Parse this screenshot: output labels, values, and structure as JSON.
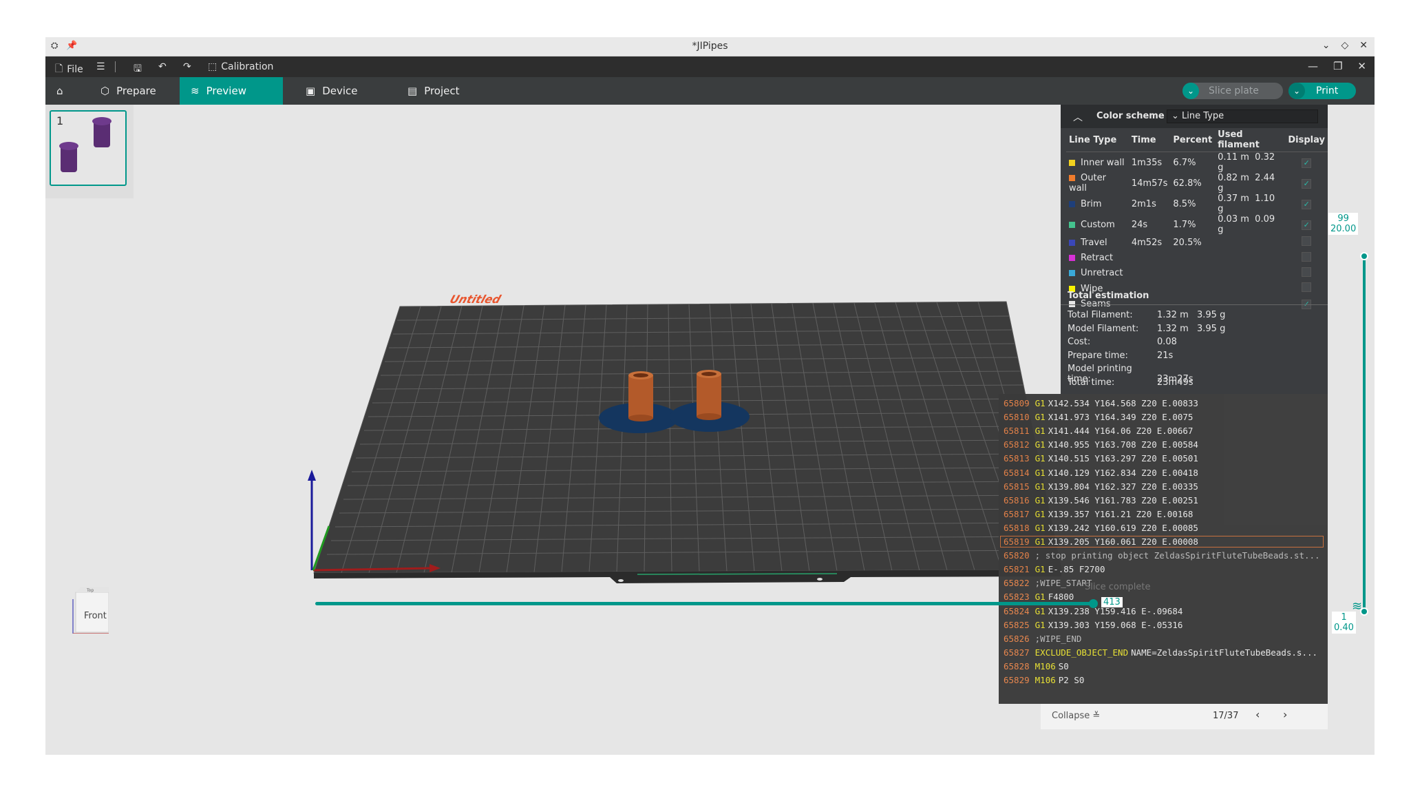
{
  "window": {
    "title": "*JIPipes"
  },
  "menubar": {
    "file_label": "File",
    "calibration_label": "Calibration"
  },
  "tabs": {
    "prepare": "Prepare",
    "preview": "Preview",
    "device": "Device",
    "project": "Project",
    "slice_plate": "Slice plate",
    "print": "Print"
  },
  "plate": {
    "thumb_number": "1",
    "bed_label": "Untitled"
  },
  "legend": {
    "title": "Color scheme",
    "scheme_value": "Line Type",
    "headers": [
      "Line Type",
      "Time",
      "Percent",
      "Used filament",
      "Display"
    ],
    "rows": [
      {
        "name": "Inner wall",
        "time": "1m35s",
        "percent": "6.7%",
        "len": "0.11 m",
        "weight": "0.32 g",
        "color": "#f2d21f",
        "display": true
      },
      {
        "name": "Outer wall",
        "time": "14m57s",
        "percent": "62.8%",
        "len": "0.82 m",
        "weight": "2.44 g",
        "color": "#f07c2c",
        "display": true
      },
      {
        "name": "Brim",
        "time": "2m1s",
        "percent": "8.5%",
        "len": "0.37 m",
        "weight": "1.10 g",
        "color": "#1e3f7a",
        "display": true
      },
      {
        "name": "Custom",
        "time": "24s",
        "percent": "1.7%",
        "len": "0.03 m",
        "weight": "0.09 g",
        "color": "#44c38e",
        "display": true
      },
      {
        "name": "Travel",
        "time": "4m52s",
        "percent": "20.5%",
        "len": "",
        "weight": "",
        "color": "#3a47b8",
        "display": false
      },
      {
        "name": "Retract",
        "time": "",
        "percent": "",
        "len": "",
        "weight": "",
        "color": "#d631d6",
        "display": false
      },
      {
        "name": "Unretract",
        "time": "",
        "percent": "",
        "len": "",
        "weight": "",
        "color": "#3aa9d8",
        "display": false
      },
      {
        "name": "Wipe",
        "time": "",
        "percent": "",
        "len": "",
        "weight": "",
        "color": "#f8f200",
        "display": false
      },
      {
        "name": "Seams",
        "time": "",
        "percent": "",
        "len": "",
        "weight": "",
        "color": "#e6e6e6",
        "display": true
      }
    ],
    "total_title": "Total estimation",
    "totals": [
      {
        "label": "Total Filament:",
        "v1": "1.32 m",
        "v2": "3.95 g"
      },
      {
        "label": "Model Filament:",
        "v1": "1.32 m",
        "v2": "3.95 g"
      },
      {
        "label": "Cost:",
        "v1": "0.08",
        "v2": ""
      },
      {
        "label": "Prepare time:",
        "v1": "21s",
        "v2": ""
      },
      {
        "label": "Model printing time:",
        "v1": "23m27s",
        "v2": ""
      },
      {
        "label": "Total time:",
        "v1": "23m49s",
        "v2": ""
      }
    ]
  },
  "gcode": [
    {
      "n": "65809",
      "k": "G1",
      "t": "X142.534 Y164.568 Z20 E.00833"
    },
    {
      "n": "65810",
      "k": "G1",
      "t": "X141.973 Y164.349 Z20 E.0075"
    },
    {
      "n": "65811",
      "k": "G1",
      "t": "X141.444 Y164.06 Z20 E.00667"
    },
    {
      "n": "65812",
      "k": "G1",
      "t": "X140.955 Y163.708 Z20 E.00584"
    },
    {
      "n": "65813",
      "k": "G1",
      "t": "X140.515 Y163.297 Z20 E.00501"
    },
    {
      "n": "65814",
      "k": "G1",
      "t": "X140.129 Y162.834 Z20 E.00418"
    },
    {
      "n": "65815",
      "k": "G1",
      "t": "X139.804 Y162.327 Z20 E.00335"
    },
    {
      "n": "65816",
      "k": "G1",
      "t": "X139.546 Y161.783 Z20 E.00251"
    },
    {
      "n": "65817",
      "k": "G1",
      "t": "X139.357 Y161.21 Z20 E.00168"
    },
    {
      "n": "65818",
      "k": "G1",
      "t": "X139.242 Y160.619 Z20 E.00085"
    },
    {
      "n": "65819",
      "k": "G1",
      "t": "X139.205 Y160.061 Z20 E.00008"
    },
    {
      "n": "65820",
      "k": "",
      "t": "; stop printing object ZeldasSpiritFluteTubeBeads.st..."
    },
    {
      "n": "65821",
      "k": "G1",
      "t": "E-.85 F2700"
    },
    {
      "n": "65822",
      "k": "",
      "t": ";WIPE_START"
    },
    {
      "n": "65823",
      "k": "G1",
      "t": "F4800"
    },
    {
      "n": "65824",
      "k": "G1",
      "t": "X139.238 Y159.416 E-.09684"
    },
    {
      "n": "65825",
      "k": "G1",
      "t": "X139.303 Y159.068 E-.05316"
    },
    {
      "n": "65826",
      "k": "",
      "t": ";WIPE_END"
    },
    {
      "n": "65827",
      "k": "EXCLUDE_OBJECT_END",
      "t": "NAME=ZeldasSpiritFluteTubeBeads.s..."
    },
    {
      "n": "65828",
      "k": "M106",
      "t": "S0"
    },
    {
      "n": "65829",
      "k": "M106",
      "t": "P2 S0"
    }
  ],
  "notification": {
    "title": "Slice complete"
  },
  "pager": {
    "collapse": "Collapse",
    "page": "17/37"
  },
  "layer_slider": {
    "top_layer": "99",
    "top_height": "20.00",
    "bottom_layer": "1",
    "bottom_height": "0.40"
  },
  "move_slider": {
    "value": "413"
  },
  "viewcube": {
    "front": "Front",
    "top": "Top"
  },
  "colors": {
    "accent": "#00978a",
    "object": "#b35a2a",
    "brim": "#1e3f7a",
    "bed": "#3c3c3c"
  }
}
